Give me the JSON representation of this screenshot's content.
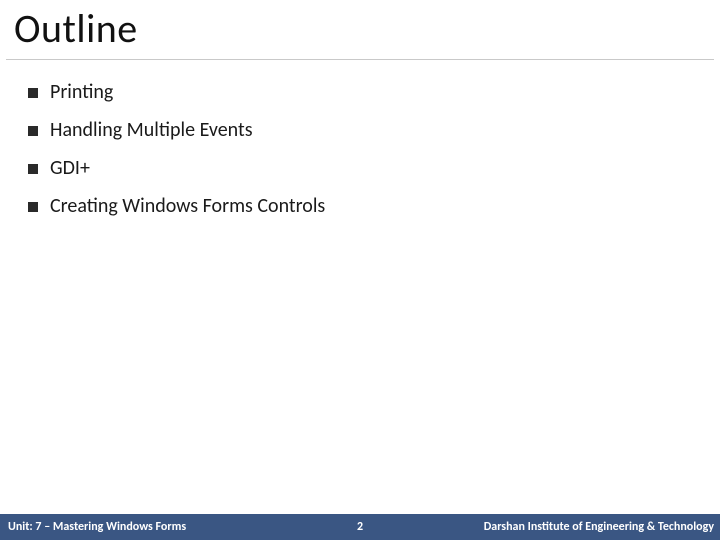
{
  "title": "Outline",
  "items": [
    "Printing",
    "Handling Multiple Events",
    "GDI+",
    "Creating Windows Forms Controls"
  ],
  "footer": {
    "left": "Unit: 7 – Mastering Windows Forms",
    "page": "2",
    "right": "Darshan Institute of Engineering & Technology"
  }
}
